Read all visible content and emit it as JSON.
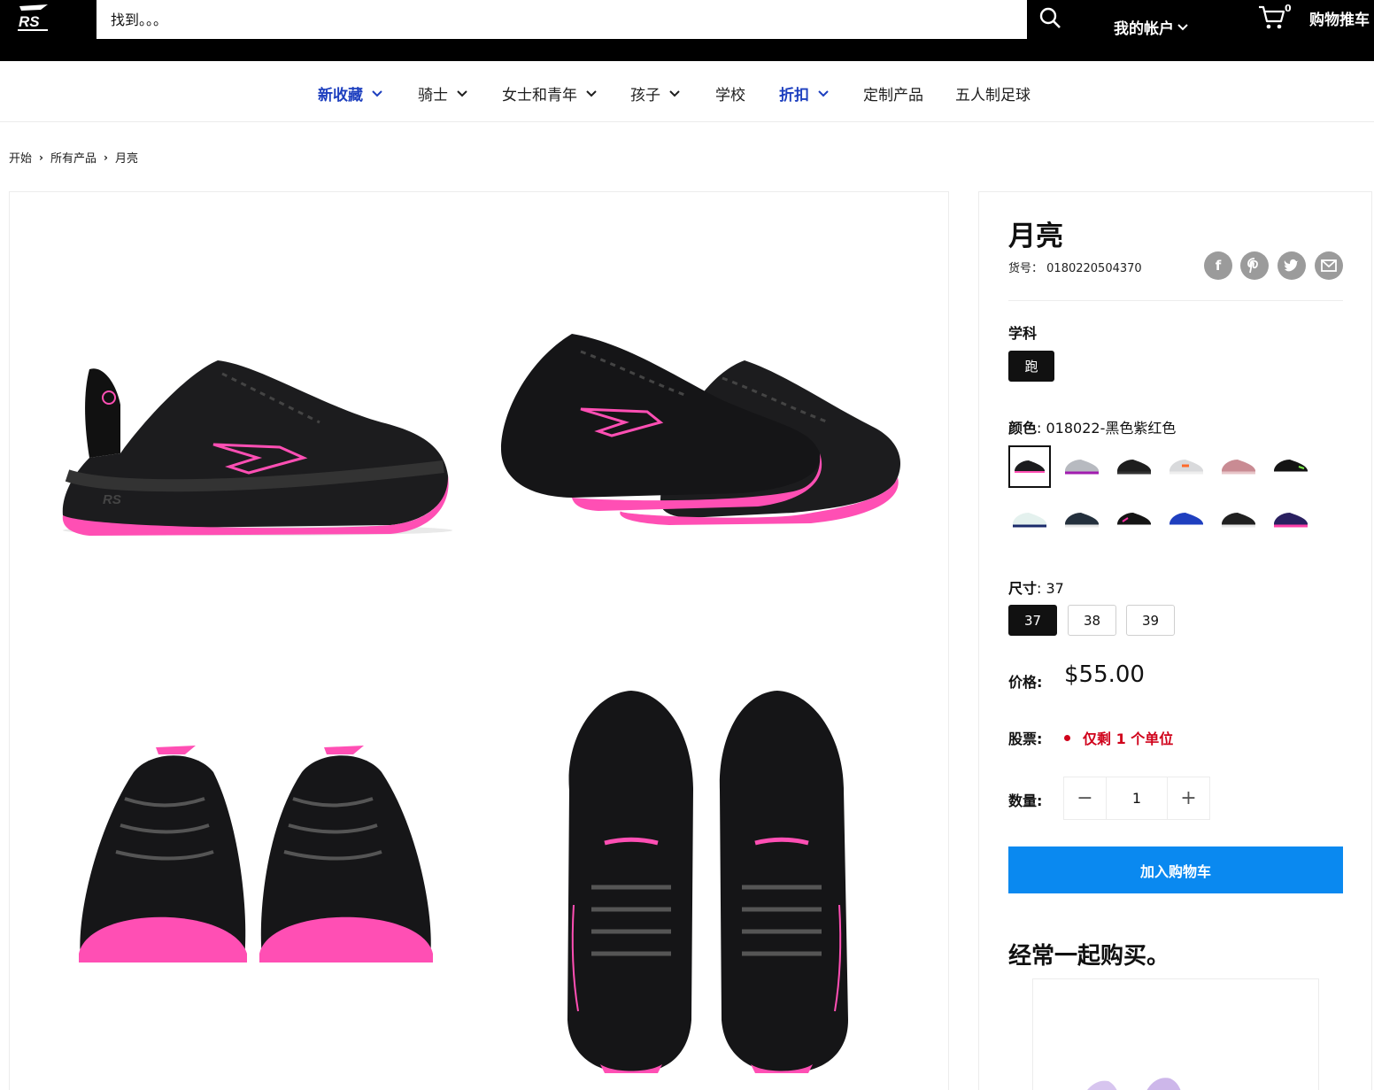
{
  "header": {
    "logo_icon": "rs-performance-logo",
    "search_placeholder": "找到。。。",
    "account_label": "我的帐户",
    "cart_count": "0",
    "cart_label": "购物推车"
  },
  "nav": {
    "items": [
      {
        "label": "新收藏",
        "dropdown": true,
        "accent": true
      },
      {
        "label": "骑士",
        "dropdown": true
      },
      {
        "label": "女士和青年",
        "dropdown": true
      },
      {
        "label": "孩子",
        "dropdown": true
      },
      {
        "label": "学校",
        "dropdown": false
      },
      {
        "label": "折扣",
        "dropdown": true,
        "accent": true
      },
      {
        "label": "定制产品",
        "dropdown": false
      },
      {
        "label": "五人制足球",
        "dropdown": false
      }
    ]
  },
  "breadcrumb": [
    "开始",
    "所有产品",
    "月亮"
  ],
  "product": {
    "title": "月亮",
    "sku_label": "货号：",
    "sku": "0180220504370",
    "share_icons": [
      "facebook-icon",
      "pinterest-icon",
      "twitter-icon",
      "email-icon"
    ],
    "discipline_label": "学科",
    "discipline_options": [
      "跑"
    ],
    "color_label": "颜色",
    "color_value": ": 018022-黑色紫红色",
    "color_swatch_count": 12,
    "size_label": "尺寸",
    "size_value": ": 37",
    "sizes": [
      "37",
      "38",
      "39"
    ],
    "selected_size": "37",
    "price_label": "价格:",
    "price": "$55.00",
    "stock_label": "股票:",
    "stock_text": "仅剩 1 个单位",
    "quantity_label": "数量:",
    "quantity": "1",
    "add_to_cart": "加入购物车",
    "bought_together_title": "经常一起购买。"
  },
  "colors": {
    "accent": "#0a89f0",
    "nav_accent": "#1d3fbf",
    "stock_red": "#d0021b",
    "shoe_pink": "#ff4fb4"
  }
}
